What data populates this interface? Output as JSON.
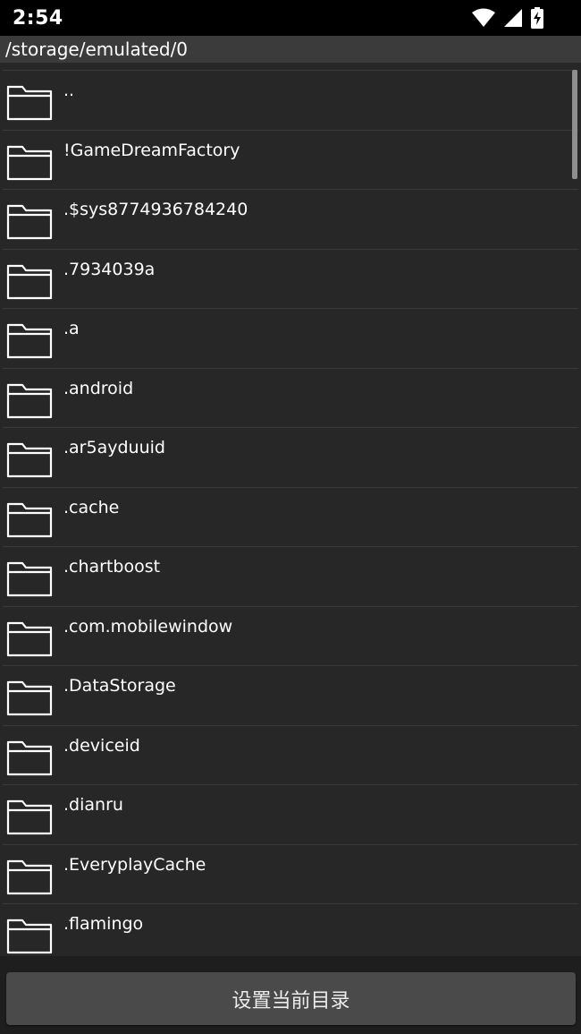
{
  "status_bar": {
    "time": "2:54",
    "icons": [
      "wifi-icon",
      "cell-signal-icon",
      "battery-charging-icon"
    ]
  },
  "path_bar": {
    "path": "/storage/emulated/0"
  },
  "file_list": {
    "items": [
      {
        "name": ".."
      },
      {
        "name": "!GameDreamFactory"
      },
      {
        "name": ".$sys8774936784240"
      },
      {
        "name": ".7934039a"
      },
      {
        "name": ".a"
      },
      {
        "name": ".android"
      },
      {
        "name": ".ar5ayduuid"
      },
      {
        "name": ".cache"
      },
      {
        "name": ".chartboost"
      },
      {
        "name": ".com.mobilewindow"
      },
      {
        "name": ".DataStorage"
      },
      {
        "name": ".deviceid"
      },
      {
        "name": ".dianru"
      },
      {
        "name": ".EveryplayCache"
      },
      {
        "name": ".flamingo"
      }
    ]
  },
  "action": {
    "set_current_dir_label": "设置当前目录"
  },
  "colors": {
    "status_bg": "#000000",
    "path_bar_bg": "#3b3b3b",
    "list_bg": "#272727",
    "divider": "#3a3a3a",
    "button_bg": "#4a4a4a"
  }
}
